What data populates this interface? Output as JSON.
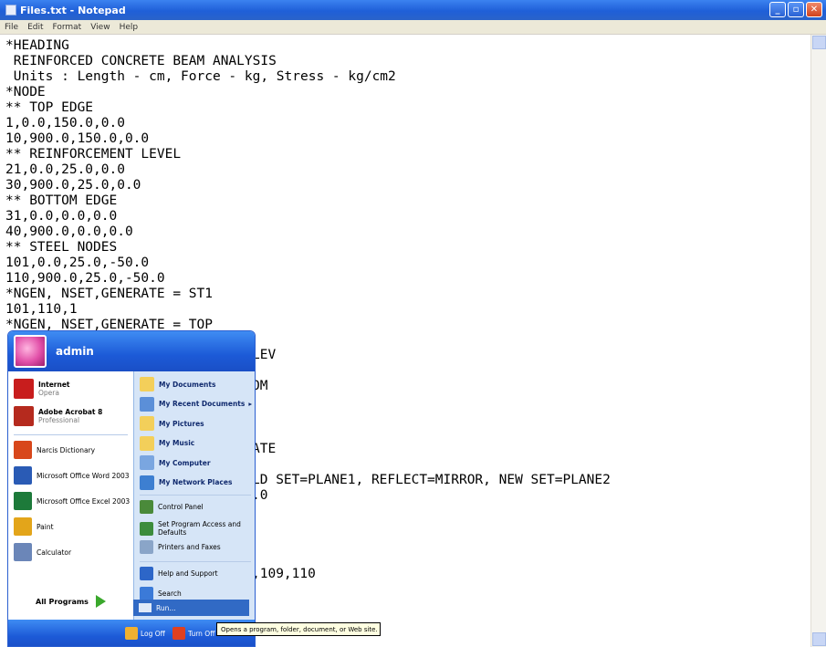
{
  "window": {
    "title": "Files.txt - Notepad"
  },
  "menu": [
    "File",
    "Edit",
    "Format",
    "View",
    "Help"
  ],
  "editor_lines": [
    "*HEADING",
    " REINFORCED CONCRETE BEAM ANALYSIS",
    " Units : Length - cm, Force - kg, Stress - kg/cm2",
    "*NODE",
    "** TOP EDGE",
    "1,0.0,150.0,0.0",
    "10,900.0,150.0,0.0",
    "** REINFORCEMENT LEVEL",
    "21,0.0,25.0,0.0",
    "30,900.0,25.0,0.0",
    "** BOTTOM EDGE",
    "31,0.0,0.0,0.0",
    "40,900.0,0.0,0.0",
    "** STEEL NODES",
    "101,0.0,25.0,-50.0",
    "110,900.0,25.0,-50.0",
    "*NGEN, NSET,GENERATE = ST1",
    "101,110,1",
    "*NGEN, NSET,GENERATE = TOP"
  ],
  "editor_fragments": [
    "LEV",
    "OM",
    "ATE",
    "LD SET=PLANE1, REFLECT=MIRROR, NEW SET=PLANE2",
    ".0",
    ",109,110"
  ],
  "start_menu": {
    "user": "admin",
    "pinned": [
      {
        "name": "Internet",
        "sub": "Opera",
        "icon": "opera-icon",
        "color": "#c81d1d"
      },
      {
        "name": "Adobe Acrobat 8",
        "sub": "Professional",
        "icon": "acrobat-icon",
        "color": "#b52a1e"
      }
    ],
    "recent": [
      {
        "name": "Narcis Dictionary",
        "icon": "dictionary-icon",
        "color": "#d8471b"
      },
      {
        "name": "Microsoft Office Word 2003",
        "icon": "word-icon",
        "color": "#2a5bb5"
      },
      {
        "name": "Microsoft Office Excel 2003",
        "icon": "excel-icon",
        "color": "#1d7a3a"
      },
      {
        "name": "Paint",
        "icon": "paint-icon",
        "color": "#e3a51a"
      },
      {
        "name": "Calculator",
        "icon": "calculator-icon",
        "color": "#6b86b8"
      }
    ],
    "all_programs": "All Programs",
    "right": [
      {
        "name": "My Documents",
        "icon": "folder-documents-icon",
        "color": "#f3cf5a"
      },
      {
        "name": "My Recent Documents",
        "icon": "recent-documents-icon",
        "color": "#5b8fd8"
      },
      {
        "name": "My Pictures",
        "icon": "folder-pictures-icon",
        "color": "#f3cf5a"
      },
      {
        "name": "My Music",
        "icon": "folder-music-icon",
        "color": "#f3cf5a"
      },
      {
        "name": "My Computer",
        "icon": "computer-icon",
        "color": "#7aa6e0"
      },
      {
        "name": "My Network Places",
        "icon": "network-icon",
        "color": "#3d7fd1"
      }
    ],
    "right_system": [
      {
        "name": "Control Panel",
        "icon": "control-panel-icon",
        "color": "#4a8a3a"
      },
      {
        "name": "Set Program Access and Defaults",
        "icon": "program-access-icon",
        "color": "#3c8c3c"
      },
      {
        "name": "Printers and Faxes",
        "icon": "printer-icon",
        "color": "#8aa5c8"
      }
    ],
    "right_help": [
      {
        "name": "Help and Support",
        "icon": "help-icon",
        "color": "#2d66c8"
      },
      {
        "name": "Search",
        "icon": "search-icon",
        "color": "#3b7ad8"
      }
    ],
    "run": "Run...",
    "log_off": "Log Off",
    "turn_off": "Turn Off",
    "tooltip": "Opens a program, folder, document, or Web site."
  }
}
